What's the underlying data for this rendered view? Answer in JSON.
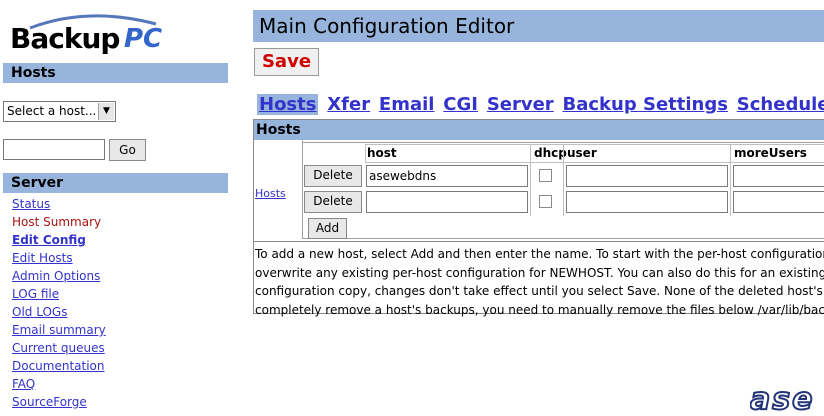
{
  "logo": {
    "text": "Backup",
    "accent": "PC"
  },
  "sidebar": {
    "hosts_header": "Hosts",
    "host_select": "Select a host...",
    "go_label": "Go",
    "server_header": "Server",
    "server_items": [
      {
        "label": "Status"
      },
      {
        "label": "Host Summary"
      },
      {
        "label": "Edit Config"
      },
      {
        "label": "Edit Hosts"
      },
      {
        "label": "Admin Options"
      },
      {
        "label": "LOG file"
      },
      {
        "label": "Old LOGs"
      },
      {
        "label": "Email summary"
      },
      {
        "label": "Current queues"
      },
      {
        "label": "Documentation"
      },
      {
        "label": "FAQ"
      },
      {
        "label": "SourceForge"
      }
    ]
  },
  "main": {
    "title": "Main Configuration Editor",
    "save_label": "Save",
    "tabs": [
      {
        "label": "Hosts"
      },
      {
        "label": "Xfer"
      },
      {
        "label": "Email"
      },
      {
        "label": "CGI"
      },
      {
        "label": "Server"
      },
      {
        "label": "Backup Settings"
      },
      {
        "label": "Schedule"
      }
    ],
    "section_header": "Hosts",
    "hosts_label": "Hosts",
    "columns": {
      "host": "host",
      "dhcp": "dhcp",
      "user": "user",
      "more_users": "moreUsers"
    },
    "rows": [
      {
        "delete_label": "Delete",
        "host": "asewebdns",
        "user": "",
        "more_users": ""
      },
      {
        "delete_label": "Delete",
        "host": "",
        "user": "",
        "more_users": ""
      }
    ],
    "add_label": "Add",
    "help_lines": [
      "To add a new host, select Add and then enter the name. To start with the per-host configuration fro",
      "overwrite any existing per-host configuration for NEWHOST. You can also do this for an existing hos",
      "configuration copy, changes don't take effect until you select Save. None of the deleted host's backu",
      "completely remove a host's backups, you need to manually remove the files below /var/lib/backuppc"
    ]
  },
  "footer_logo": "ase",
  "colors": {
    "header_bg": "#96b4dc",
    "link": "#3333cc",
    "save": "#d00000",
    "active_nav": "#aa1111"
  }
}
